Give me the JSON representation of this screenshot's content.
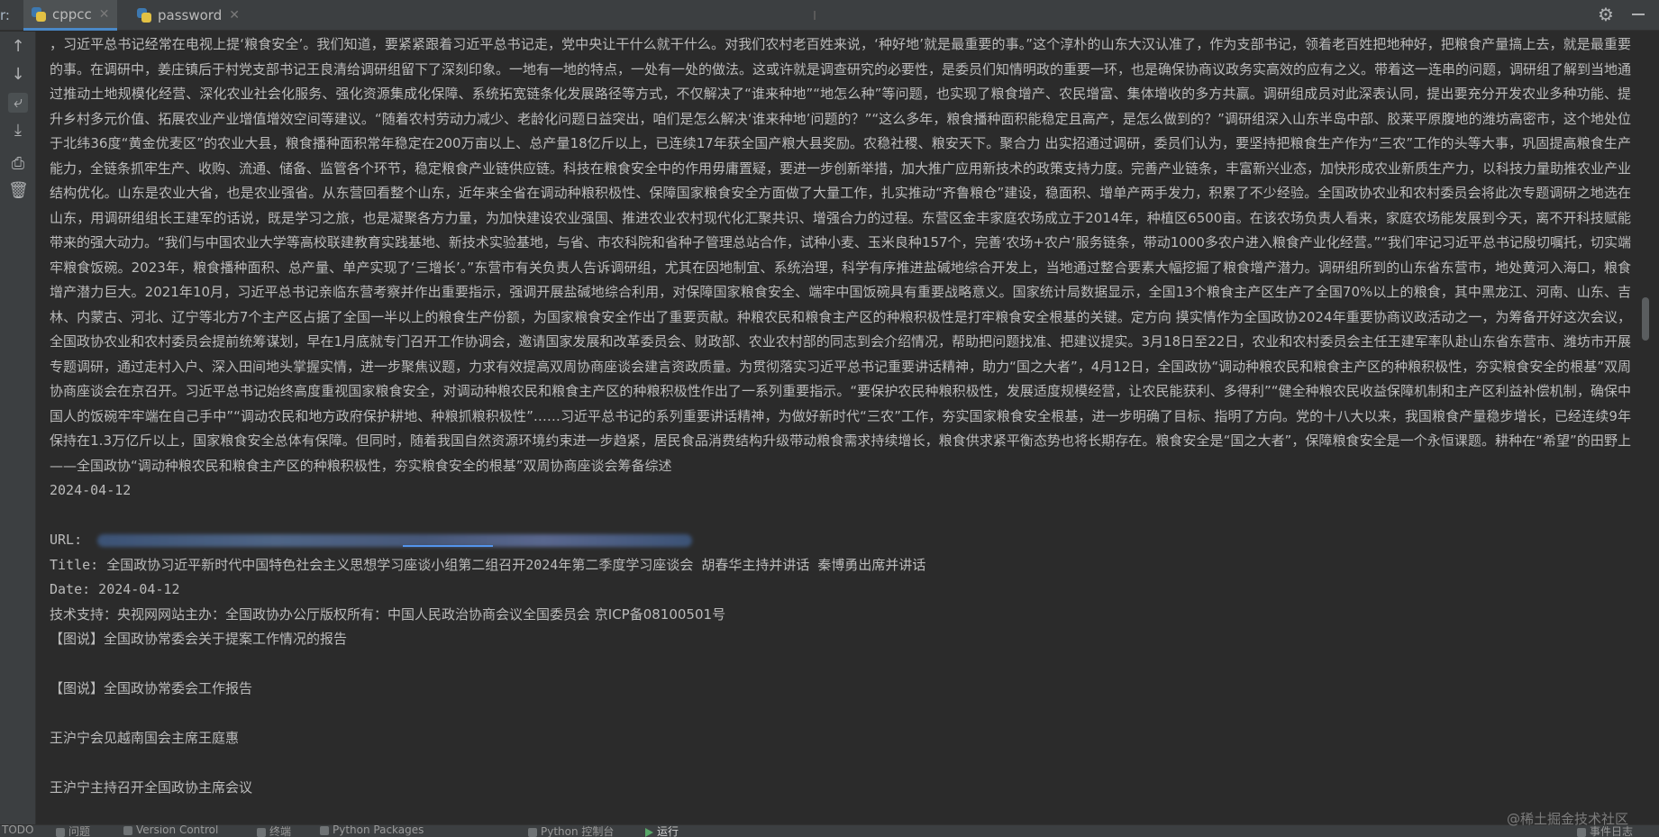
{
  "tabbar": {
    "run_prefix": "r:",
    "tabs": [
      {
        "label": "cppcc",
        "active": true
      },
      {
        "label": "password",
        "active": false
      }
    ]
  },
  "console": {
    "article_text": "，习近平总书记经常在电视上提‘粮食安全’。我们知道，要紧紧跟着习近平总书记走，党中央让干什么就干什么。对我们农村老百姓来说，‘种好地’就是最重要的事。”这个淳朴的山东大汉认准了，作为支部书记，领着老百姓把地种好，把粮食产量搞上去，就是最重要的事。在调研中，姜庄镇后于村党支部书记王良清给调研组留下了深刻印象。一地有一地的特点，一处有一处的做法。这或许就是调查研究的必要性，是委员们知情明政的重要一环，也是确保协商议政务实高效的应有之义。带着这一连串的问题，调研组了解到当地通过推动土地规模化经营、深化农业社会化服务、强化资源集成化保障、系统拓宽链条化发展路径等方式，不仅解决了“谁来种地”“地怎么种”等问题，也实现了粮食增产、农民增富、集体增收的多方共赢。调研组成员对此深表认同，提出要充分开发农业多种功能、提升乡村多元价值、拓展农业产业增值增效空间等建议。“随着农村劳动力减少、老龄化问题日益突出，咱们是怎么解决‘谁来种地’问题的？”“这么多年，粮食播种面积能稳定且高产，是怎么做到的？”调研组深入山东半岛中部、胶莱平原腹地的潍坊高密市，这个地处位于北纬36度“黄金优麦区”的农业大县，粮食播种面积常年稳定在200万亩以上、总产量18亿斤以上，已连续17年获全国产粮大县奖励。农稳社稷、粮安天下。聚合力 出实招通过调研，委员们认为，要坚持把粮食生产作为“三农”工作的头等大事，巩固提高粮食生产能力，全链条抓牢生产、收购、流通、储备、监管各个环节，稳定粮食产业链供应链。科技在粮食安全中的作用毋庸置疑，要进一步创新举措，加大推广应用新技术的政策支持力度。完善产业链条，丰富新兴业态，加快形成农业新质生产力，以科技力量助推农业产业结构优化。山东是农业大省，也是农业强省。从东营回看整个山东，近年来全省在调动种粮积极性、保障国家粮食安全方面做了大量工作，扎实推动“齐鲁粮仓”建设，稳面积、增单产两手发力，积累了不少经验。全国政协农业和农村委员会将此次专题调研之地选在山东，用调研组组长王建军的话说，既是学习之旅，也是凝聚各方力量，为加快建设农业强国、推进农业农村现代化汇聚共识、增强合力的过程。东营区金丰家庭农场成立于2014年，种植区6500亩。在该农场负责人看来，家庭农场能发展到今天，离不开科技赋能带来的强大动力。“我们与中国农业大学等高校联建教育实践基地、新技术实验基地，与省、市农科院和省种子管理总站合作，试种小麦、玉米良种157个，完善‘农场+农户’服务链条，带动1000多农户进入粮食产业化经营。”“我们牢记习近平总书记殷切嘱托，切实端牢粮食饭碗。2023年，粮食播种面积、总产量、单产实现了‘三增长’。”东营市有关负责人告诉调研组，尤其在因地制宜、系统治理，科学有序推进盐碱地综合开发上，当地通过整合要素大幅挖掘了粮食增产潜力。调研组所到的山东省东营市，地处黄河入海口，粮食增产潜力巨大。2021年10月，习近平总书记亲临东营考察并作出重要指示，强调开展盐碱地综合利用，对保障国家粮食安全、端牢中国饭碗具有重要战略意义。国家统计局数据显示，全国13个粮食主产区生产了全国70%以上的粮食，其中黑龙江、河南、山东、吉林、内蒙古、河北、辽宁等北方7个主产区占据了全国一半以上的粮食生产份额，为国家粮食安全作出了重要贡献。种粮农民和粮食主产区的种粮积极性是打牢粮食安全根基的关键。定方向 摸实情作为全国政协2024年重要协商议政活动之一，为筹备开好这次会议，全国政协农业和农村委员会提前统筹谋划，早在1月底就专门召开工作协调会，邀请国家发展和改革委员会、财政部、农业农村部的同志到会介绍情况，帮助把问题找准、把建议提实。3月18日至22日，农业和农村委员会主任王建军率队赴山东省东营市、潍坊市开展专题调研，通过走村入户、深入田间地头掌握实情，进一步聚焦议题，力求有效提高双周协商座谈会建言资政质量。为贯彻落实习近平总书记重要讲话精神，助力“国之大者”，4月12日，全国政协“调动种粮农民和粮食主产区的种粮积极性，夯实粮食安全的根基”双周协商座谈会在京召开。习近平总书记始终高度重视国家粮食安全，对调动种粮农民和粮食主产区的种粮积极性作出了一系列重要指示。“要保护农民种粮积极性，发展适度规模经营，让农民能获利、多得利”“健全种粮农民收益保障机制和主产区利益补偿机制，确保中国人的饭碗牢牢端在自己手中”“调动农民和地方政府保护耕地、种粮抓粮积极性”……习近平总书记的系列重要讲话精神，为做好新时代“三农”工作，夯实国家粮食安全根基，进一步明确了目标、指明了方向。党的十八大以来，我国粮食产量稳步增长，已经连续9年保持在1.3万亿斤以上，国家粮食安全总体有保障。但同时，随着我国自然资源环境约束进一步趋紧，居民食品消费结构升级带动粮食需求持续增长，粮食供求紧平衡态势也将长期存在。粮食安全是“国之大者”，保障粮食安全是一个永恒课题。耕种在“希望”的田野上——全国政协“调动种粮农民和粮食主产区的种粮积极性，夯实粮食安全的根基”双周协商座谈会筹备综述",
    "article_date": "2024-04-12",
    "url_label": "URL:",
    "title_line": "Title: 全国政协习近平新时代中国特色社会主义思想学习座谈小组第二组召开2024年第二季度学习座谈会 胡春华主持并讲话 秦博勇出席并讲话",
    "date_line": "Date: 2024-04-12",
    "support_line": "技术支持：央视网网站主办：全国政协办公厅版权所有：中国人民政治协商会议全国委员会 京ICP备08100501号",
    "items": [
      "【图说】全国政协常委会关于提案工作情况的报告",
      "【图说】全国政协常委会工作报告",
      "王沪宁会见越南国会主席王庭惠",
      "王沪宁主持召开全国政协主席会议"
    ]
  },
  "bottombar": {
    "items": [
      "TODO",
      "问题",
      "Version Control",
      "终端",
      "Python Packages",
      "Python 控制台",
      "运行",
      "事件日志"
    ]
  },
  "watermark": "@稀土掘金技术社区",
  "colors": {
    "background": "#2b2b2b",
    "text": "#bbbbbb",
    "tab_accent": "#4a88c7",
    "link": "#5394ec"
  }
}
